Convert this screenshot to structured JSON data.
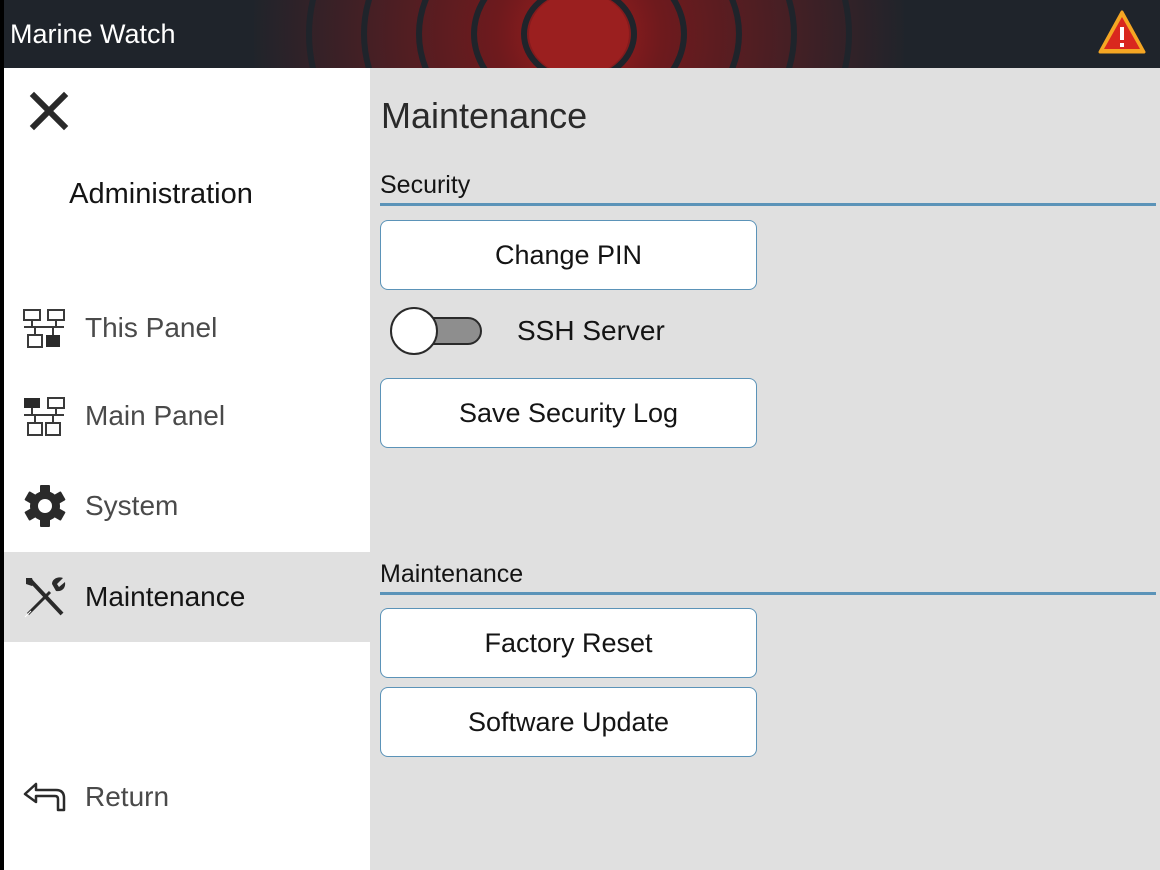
{
  "app": {
    "title": "Marine Watch",
    "alert_icon": "warning-triangle-icon",
    "colors": {
      "header_bg": "#1f242b",
      "alert_fill": "#d9271e",
      "alert_outline": "#f5a623",
      "accent": "#5b93b8"
    }
  },
  "sidebar": {
    "close_icon": "close-icon",
    "title": "Administration",
    "items": [
      {
        "label": "This Panel",
        "icon": "network-panel-icon",
        "active": false
      },
      {
        "label": "Main Panel",
        "icon": "network-main-icon",
        "active": false
      },
      {
        "label": "System",
        "icon": "gear-icon",
        "active": false
      },
      {
        "label": "Maintenance",
        "icon": "tools-icon",
        "active": true
      }
    ],
    "return_label": "Return",
    "return_icon": "return-arrow-icon"
  },
  "main": {
    "title": "Maintenance",
    "security": {
      "header": "Security",
      "change_pin_label": "Change PIN",
      "ssh_label": "SSH Server",
      "ssh_enabled": false,
      "save_log_label": "Save Security Log"
    },
    "maintenance": {
      "header": "Maintenance",
      "factory_reset_label": "Factory Reset",
      "software_update_label": "Software Update"
    }
  }
}
